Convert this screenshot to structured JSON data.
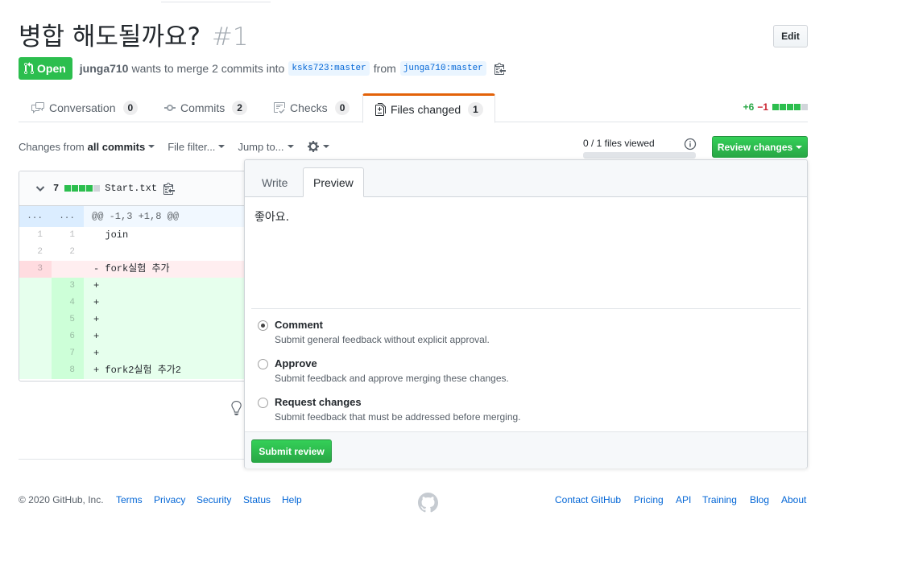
{
  "pr": {
    "title": "병합 해도될까요?",
    "number": "#1",
    "edit_label": "Edit",
    "state": "Open",
    "author": "junga710",
    "merge_text": "wants to merge 2 commits into",
    "base_branch": "ksks723:master",
    "from_text": "from",
    "head_branch": "junga710:master"
  },
  "tabs": [
    {
      "label": "Conversation",
      "count": "0",
      "icon": "conversation-icon"
    },
    {
      "label": "Commits",
      "count": "2",
      "icon": "commit-icon"
    },
    {
      "label": "Checks",
      "count": "0",
      "icon": "checks-icon"
    },
    {
      "label": "Files changed",
      "count": "1",
      "icon": "file-diff-icon",
      "selected": true
    }
  ],
  "diffstat": {
    "additions": "+6",
    "deletions": "−1",
    "blocks": [
      "added",
      "added",
      "added",
      "added",
      "neutral"
    ]
  },
  "toolbar": {
    "changes_from": "Changes from",
    "changes_value": "all commits",
    "file_filter": "File filter...",
    "jump_to": "Jump to...",
    "viewed_text": "0 / 1 files viewed",
    "viewed_progress": 0,
    "review_button": "Review changes"
  },
  "file": {
    "changes_count": "7",
    "name": "Start.txt",
    "blocks": [
      "added",
      "added",
      "added",
      "added",
      "neutral"
    ],
    "hunk_left": "...",
    "hunk_right": "...",
    "hunk_header": "@@ -1,3 +1,8 @@",
    "lines": [
      {
        "type": "context",
        "old": "1",
        "new": "1",
        "text": "  join"
      },
      {
        "type": "context",
        "old": "2",
        "new": "2",
        "text": ""
      },
      {
        "type": "del",
        "old": "3",
        "new": "",
        "text": "- fork실험 추가"
      },
      {
        "type": "add",
        "old": "",
        "new": "3",
        "text": "+"
      },
      {
        "type": "add",
        "old": "",
        "new": "4",
        "text": "+"
      },
      {
        "type": "add",
        "old": "",
        "new": "5",
        "text": "+"
      },
      {
        "type": "add",
        "old": "",
        "new": "6",
        "text": "+"
      },
      {
        "type": "add",
        "old": "",
        "new": "7",
        "text": "+"
      },
      {
        "type": "add",
        "old": "",
        "new": "8",
        "text": "+ fork2실험 추가2"
      }
    ]
  },
  "review": {
    "write_tab": "Write",
    "preview_tab": "Preview",
    "preview_text": "좋아요.",
    "options": [
      {
        "label": "Comment",
        "desc": "Submit general feedback without explicit approval.",
        "checked": true
      },
      {
        "label": "Approve",
        "desc": "Submit feedback and approve merging these changes.",
        "checked": false
      },
      {
        "label": "Request changes",
        "desc": "Submit feedback that must be addressed before merging.",
        "checked": false
      }
    ],
    "submit_label": "Submit review"
  },
  "footer": {
    "copyright": "© 2020 GitHub, Inc.",
    "left_links": [
      "Terms",
      "Privacy",
      "Security",
      "Status",
      "Help"
    ],
    "right_links": [
      "Contact GitHub",
      "Pricing",
      "API",
      "Training",
      "Blog",
      "About"
    ]
  },
  "colors": {
    "open": "#2cbe4e",
    "link": "#0366d6",
    "tab_accent": "#e36209",
    "added": "#e6ffed",
    "deleted": "#ffeef0"
  }
}
